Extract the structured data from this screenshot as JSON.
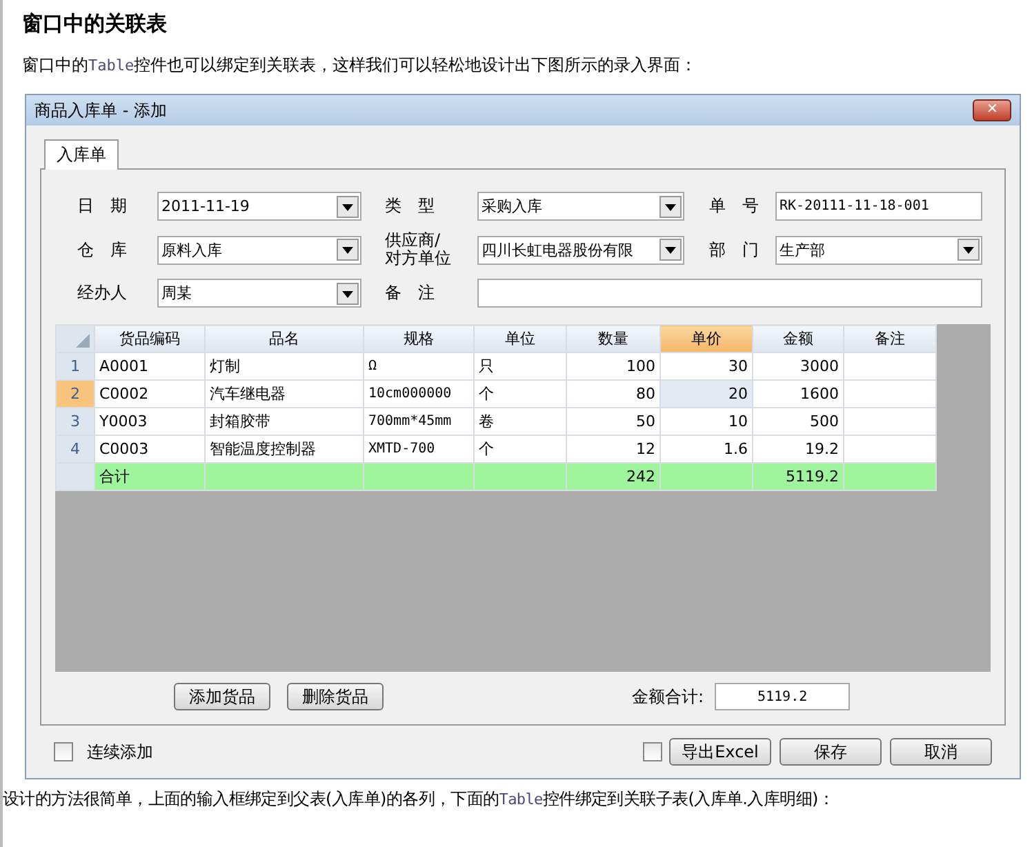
{
  "heading": "窗口中的关联表",
  "intro": [
    {
      "text": "窗口中的",
      "kind": "plain"
    },
    {
      "text": "Table",
      "kind": "code"
    },
    {
      "text": "控件也可以绑定到关联表，这样我们可以轻松地设计出下图所示的录入界面：",
      "kind": "plain"
    }
  ],
  "window": {
    "title": "商品入库单 - 添加",
    "close": "✕"
  },
  "tabs": [
    {
      "label": "入库单",
      "selected": true
    }
  ],
  "fields": [
    {
      "label": "日　期",
      "value": "2011-11-19",
      "kind": "combo"
    },
    {
      "label": "类　型",
      "value": "采购入库",
      "kind": "combo"
    },
    {
      "label": "单　号",
      "value": "RK-20111-11-18-001",
      "kind": "text"
    },
    {
      "label": "仓　库",
      "value": "原料入库",
      "kind": "combo"
    },
    {
      "label": "供应商/\n对方单位",
      "value": "四川长虹电器股份有限",
      "kind": "combo"
    },
    {
      "label": "部　门",
      "value": "生产部",
      "kind": "combo"
    },
    {
      "label": "经办人",
      "value": "周某",
      "kind": "combo"
    },
    {
      "label": "备　注",
      "kind": "wide"
    }
  ],
  "table": {
    "columns": [
      {
        "label": "货品编码",
        "selected": false,
        "kind": "text"
      },
      {
        "label": "品名",
        "selected": false,
        "kind": "text"
      },
      {
        "label": "规格",
        "selected": false,
        "kind": "code"
      },
      {
        "label": "单位",
        "selected": false,
        "kind": "text"
      },
      {
        "label": "数量",
        "selected": false,
        "kind": "number"
      },
      {
        "label": "单价",
        "selected": true,
        "kind": "number"
      },
      {
        "label": "金额",
        "selected": false,
        "kind": "number"
      },
      {
        "label": "备注",
        "selected": false,
        "kind": "text"
      }
    ],
    "rows": [
      {
        "number": "1",
        "selected": false,
        "cells": [
          "A0001",
          "灯制",
          "Ω",
          "只",
          "100",
          "30",
          "3000",
          ""
        ]
      },
      {
        "number": "2",
        "selected": true,
        "cells": [
          "C0002",
          "汽车继电器",
          "10cm000000",
          "个",
          "80",
          "20",
          "1600",
          ""
        ]
      },
      {
        "number": "3",
        "selected": false,
        "cells": [
          "Y0003",
          "封箱胶带",
          "700mm*45mm",
          "卷",
          "50",
          "10",
          "500",
          ""
        ]
      },
      {
        "number": "4",
        "selected": false,
        "cells": [
          "C0003",
          "智能温度控制器",
          "XMTD-700",
          "个",
          "12",
          "1.6",
          "19.2",
          ""
        ]
      }
    ],
    "total": {
      "cells": [
        "合计",
        "",
        "",
        "",
        "242",
        "",
        "5119.2",
        ""
      ]
    }
  },
  "grid_buttons": [
    "添加货品",
    "删除货品"
  ],
  "sum": {
    "label": "金额合计:",
    "value": "5119.2"
  },
  "continuous": {
    "label": "连续添加",
    "checked": false
  },
  "export": {
    "label": "导出Excel",
    "checked": false
  },
  "actions": [
    "保存",
    "取消"
  ],
  "outro": [
    {
      "text": "设计的方法很简单，上面的输入框绑定到父表(入库单)的各列，下面的",
      "kind": "plain"
    },
    {
      "text": "Table",
      "kind": "code"
    },
    {
      "text": "控件绑定到关联子表(入库单.入库明细)：",
      "kind": "plain"
    }
  ]
}
